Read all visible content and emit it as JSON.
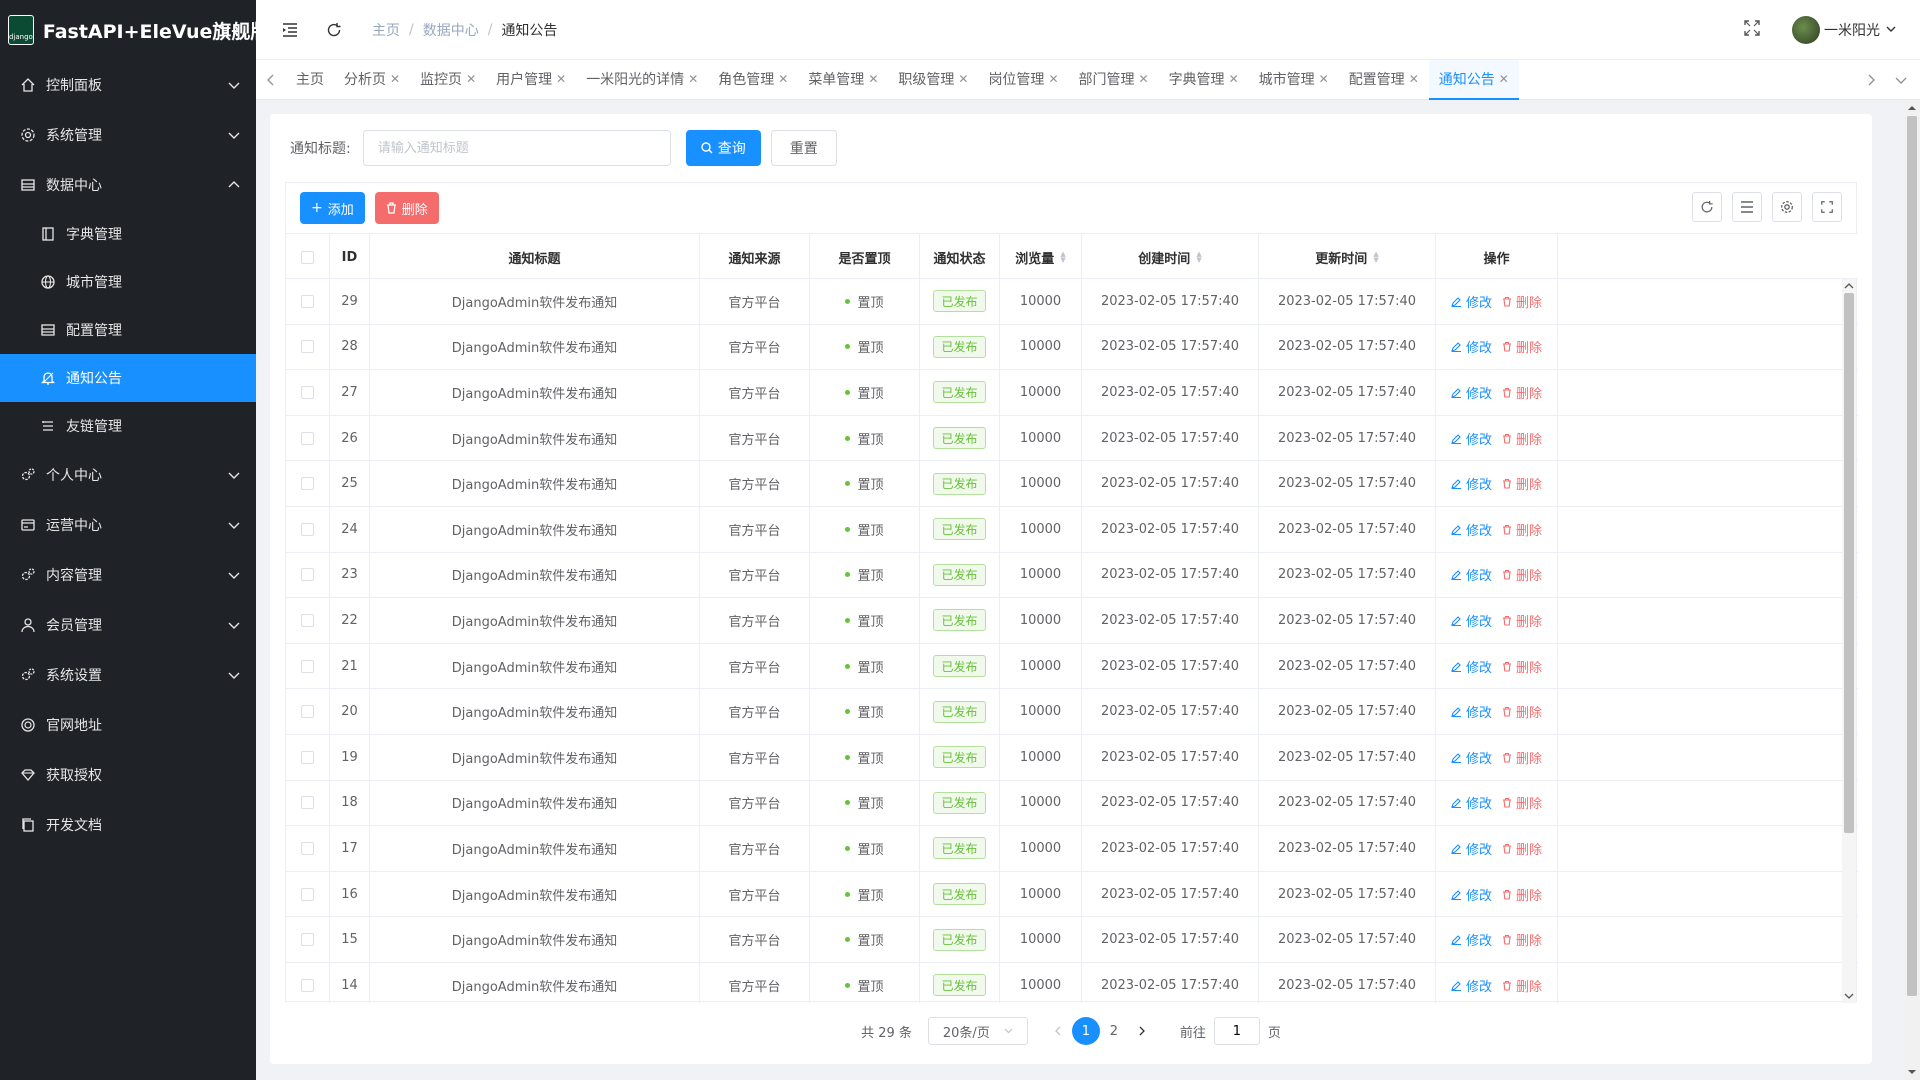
{
  "app": {
    "title": "FastAPI+EleVue旗舰版",
    "logo_text": "django"
  },
  "sidebar": {
    "items": [
      {
        "label": "控制面板",
        "icon": "home-icon",
        "sub": false,
        "active": false,
        "arrow": "down"
      },
      {
        "label": "系统管理",
        "icon": "gear-icon",
        "sub": false,
        "active": false,
        "arrow": "down"
      },
      {
        "label": "数据中心",
        "icon": "database-icon",
        "sub": false,
        "active": false,
        "arrow": "up"
      },
      {
        "label": "字典管理",
        "icon": "notebook-icon",
        "sub": true,
        "active": false,
        "arrow": ""
      },
      {
        "label": "城市管理",
        "icon": "globe-icon",
        "sub": true,
        "active": false,
        "arrow": ""
      },
      {
        "label": "配置管理",
        "icon": "list-icon",
        "sub": true,
        "active": false,
        "arrow": ""
      },
      {
        "label": "通知公告",
        "icon": "bell-icon",
        "sub": true,
        "active": true,
        "arrow": ""
      },
      {
        "label": "友链管理",
        "icon": "link-icon",
        "sub": true,
        "active": false,
        "arrow": ""
      },
      {
        "label": "个人中心",
        "icon": "gears-icon",
        "sub": false,
        "active": false,
        "arrow": "down"
      },
      {
        "label": "运营中心",
        "icon": "card-icon",
        "sub": false,
        "active": false,
        "arrow": "down"
      },
      {
        "label": "内容管理",
        "icon": "gears-icon",
        "sub": false,
        "active": false,
        "arrow": "down"
      },
      {
        "label": "会员管理",
        "icon": "user-icon",
        "sub": false,
        "active": false,
        "arrow": "down"
      },
      {
        "label": "系统设置",
        "icon": "gears-icon",
        "sub": false,
        "active": false,
        "arrow": "down"
      },
      {
        "label": "官网地址",
        "icon": "circle-icon",
        "sub": false,
        "active": false,
        "arrow": ""
      },
      {
        "label": "获取授权",
        "icon": "diamond-icon",
        "sub": false,
        "active": false,
        "arrow": ""
      },
      {
        "label": "开发文档",
        "icon": "copy-icon",
        "sub": false,
        "active": false,
        "arrow": ""
      }
    ]
  },
  "header": {
    "breadcrumb": [
      "主页",
      "数据中心",
      "通知公告"
    ],
    "user": "一米阳光"
  },
  "tabs": [
    {
      "label": "主页",
      "closable": false,
      "active": false
    },
    {
      "label": "分析页",
      "closable": true,
      "active": false
    },
    {
      "label": "监控页",
      "closable": true,
      "active": false
    },
    {
      "label": "用户管理",
      "closable": true,
      "active": false
    },
    {
      "label": "一米阳光的详情",
      "closable": true,
      "active": false
    },
    {
      "label": "角色管理",
      "closable": true,
      "active": false
    },
    {
      "label": "菜单管理",
      "closable": true,
      "active": false
    },
    {
      "label": "职级管理",
      "closable": true,
      "active": false
    },
    {
      "label": "岗位管理",
      "closable": true,
      "active": false
    },
    {
      "label": "部门管理",
      "closable": true,
      "active": false
    },
    {
      "label": "字典管理",
      "closable": true,
      "active": false
    },
    {
      "label": "城市管理",
      "closable": true,
      "active": false
    },
    {
      "label": "配置管理",
      "closable": true,
      "active": false
    },
    {
      "label": "通知公告",
      "closable": true,
      "active": true
    }
  ],
  "search": {
    "label": "通知标题:",
    "placeholder": "请输入通知标题",
    "value": "",
    "query_button": "查询",
    "reset_button": "重置"
  },
  "toolbar": {
    "add_label": "添加",
    "delete_label": "删除"
  },
  "table": {
    "columns": [
      {
        "label": "",
        "sortable": false
      },
      {
        "label": "ID",
        "sortable": false
      },
      {
        "label": "通知标题",
        "sortable": false
      },
      {
        "label": "通知来源",
        "sortable": false
      },
      {
        "label": "是否置顶",
        "sortable": false
      },
      {
        "label": "通知状态",
        "sortable": false
      },
      {
        "label": "浏览量",
        "sortable": true
      },
      {
        "label": "创建时间",
        "sortable": true
      },
      {
        "label": "更新时间",
        "sortable": true
      },
      {
        "label": "操作",
        "sortable": false
      }
    ],
    "rows": [
      {
        "id": "29",
        "title": "DjangoAdmin软件发布通知",
        "source": "官方平台",
        "top": "置顶",
        "status": "已发布",
        "views": "10000",
        "created": "2023-02-05 17:57:40",
        "updated": "2023-02-05 17:57:40"
      },
      {
        "id": "28",
        "title": "DjangoAdmin软件发布通知",
        "source": "官方平台",
        "top": "置顶",
        "status": "已发布",
        "views": "10000",
        "created": "2023-02-05 17:57:40",
        "updated": "2023-02-05 17:57:40"
      },
      {
        "id": "27",
        "title": "DjangoAdmin软件发布通知",
        "source": "官方平台",
        "top": "置顶",
        "status": "已发布",
        "views": "10000",
        "created": "2023-02-05 17:57:40",
        "updated": "2023-02-05 17:57:40"
      },
      {
        "id": "26",
        "title": "DjangoAdmin软件发布通知",
        "source": "官方平台",
        "top": "置顶",
        "status": "已发布",
        "views": "10000",
        "created": "2023-02-05 17:57:40",
        "updated": "2023-02-05 17:57:40"
      },
      {
        "id": "25",
        "title": "DjangoAdmin软件发布通知",
        "source": "官方平台",
        "top": "置顶",
        "status": "已发布",
        "views": "10000",
        "created": "2023-02-05 17:57:40",
        "updated": "2023-02-05 17:57:40"
      },
      {
        "id": "24",
        "title": "DjangoAdmin软件发布通知",
        "source": "官方平台",
        "top": "置顶",
        "status": "已发布",
        "views": "10000",
        "created": "2023-02-05 17:57:40",
        "updated": "2023-02-05 17:57:40"
      },
      {
        "id": "23",
        "title": "DjangoAdmin软件发布通知",
        "source": "官方平台",
        "top": "置顶",
        "status": "已发布",
        "views": "10000",
        "created": "2023-02-05 17:57:40",
        "updated": "2023-02-05 17:57:40"
      },
      {
        "id": "22",
        "title": "DjangoAdmin软件发布通知",
        "source": "官方平台",
        "top": "置顶",
        "status": "已发布",
        "views": "10000",
        "created": "2023-02-05 17:57:40",
        "updated": "2023-02-05 17:57:40"
      },
      {
        "id": "21",
        "title": "DjangoAdmin软件发布通知",
        "source": "官方平台",
        "top": "置顶",
        "status": "已发布",
        "views": "10000",
        "created": "2023-02-05 17:57:40",
        "updated": "2023-02-05 17:57:40"
      },
      {
        "id": "20",
        "title": "DjangoAdmin软件发布通知",
        "source": "官方平台",
        "top": "置顶",
        "status": "已发布",
        "views": "10000",
        "created": "2023-02-05 17:57:40",
        "updated": "2023-02-05 17:57:40"
      },
      {
        "id": "19",
        "title": "DjangoAdmin软件发布通知",
        "source": "官方平台",
        "top": "置顶",
        "status": "已发布",
        "views": "10000",
        "created": "2023-02-05 17:57:40",
        "updated": "2023-02-05 17:57:40"
      },
      {
        "id": "18",
        "title": "DjangoAdmin软件发布通知",
        "source": "官方平台",
        "top": "置顶",
        "status": "已发布",
        "views": "10000",
        "created": "2023-02-05 17:57:40",
        "updated": "2023-02-05 17:57:40"
      },
      {
        "id": "17",
        "title": "DjangoAdmin软件发布通知",
        "source": "官方平台",
        "top": "置顶",
        "status": "已发布",
        "views": "10000",
        "created": "2023-02-05 17:57:40",
        "updated": "2023-02-05 17:57:40"
      },
      {
        "id": "16",
        "title": "DjangoAdmin软件发布通知",
        "source": "官方平台",
        "top": "置顶",
        "status": "已发布",
        "views": "10000",
        "created": "2023-02-05 17:57:40",
        "updated": "2023-02-05 17:57:40"
      },
      {
        "id": "15",
        "title": "DjangoAdmin软件发布通知",
        "source": "官方平台",
        "top": "置顶",
        "status": "已发布",
        "views": "10000",
        "created": "2023-02-05 17:57:40",
        "updated": "2023-02-05 17:57:40"
      },
      {
        "id": "14",
        "title": "DjangoAdmin软件发布通知",
        "source": "官方平台",
        "top": "置顶",
        "status": "已发布",
        "views": "10000",
        "created": "2023-02-05 17:57:40",
        "updated": "2023-02-05 17:57:40"
      }
    ],
    "edit_label": "修改",
    "delete_label": "删除"
  },
  "pagination": {
    "total_text": "共 29 条",
    "page_size": "20条/页",
    "pages": [
      "1",
      "2"
    ],
    "current": "1",
    "goto_label": "前往",
    "goto_value": "1",
    "page_suffix": "页"
  },
  "colors": {
    "primary": "#1890ff",
    "danger": "#f56c6c",
    "success": "#67c23a",
    "sidebar_bg": "#1f2227"
  }
}
